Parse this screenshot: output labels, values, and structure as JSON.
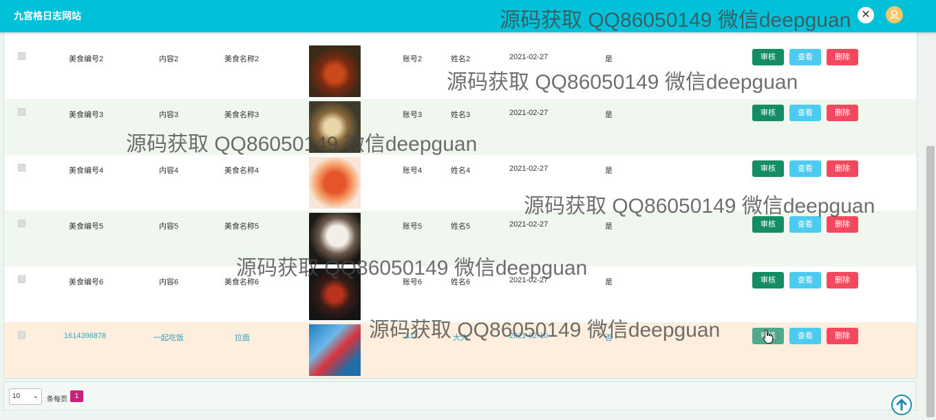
{
  "header": {
    "site_title": "九宫格日志网站",
    "close_icon": "close-icon",
    "avatar_icon": "user-avatar-icon",
    "bg_color": "#00c1d8"
  },
  "table": {
    "rows": [
      {
        "code": "美食编号2",
        "content": "内容2",
        "name": "美食名称2",
        "account": "账号2",
        "person": "姓名2",
        "date": "2021-02-27",
        "flag": "是"
      },
      {
        "code": "美食编号3",
        "content": "内容3",
        "name": "美食名称3",
        "account": "账号3",
        "person": "姓名3",
        "date": "2021-02-27",
        "flag": "是"
      },
      {
        "code": "美食编号4",
        "content": "内容4",
        "name": "美食名称4",
        "account": "账号4",
        "person": "姓名4",
        "date": "2021-02-27",
        "flag": "是"
      },
      {
        "code": "美食编号5",
        "content": "内容5",
        "name": "美食名称5",
        "account": "账号5",
        "person": "姓名5",
        "date": "2021-02-27",
        "flag": "是"
      },
      {
        "code": "美食编号6",
        "content": "内容6",
        "name": "美食名称6",
        "account": "账号6",
        "person": "姓名6",
        "date": "2021-02-27",
        "flag": "是"
      },
      {
        "code": "1614396878",
        "content": "一起吃饭",
        "name": "拉面",
        "account": "111",
        "person": "大大",
        "date": "2021-02-10",
        "flag": "否"
      }
    ],
    "buttons": {
      "review": "审核",
      "view": "查看",
      "delete": "删除"
    },
    "colors": {
      "review": "#148d67",
      "view": "#4dcaf0",
      "delete": "#f4485f",
      "hover_row": "#fdeedd",
      "even_row": "#f0f7ee"
    }
  },
  "pagination": {
    "page_size": "10",
    "per_page_label": "条每页",
    "current_page": "1",
    "accent": "#c8207c"
  },
  "watermark": {
    "text": "源码获取 QQ86050149 微信deepguan"
  },
  "icons": {
    "back_to_top": "arrow-up-circle-icon",
    "cursor": "hand-pointer-icon"
  }
}
